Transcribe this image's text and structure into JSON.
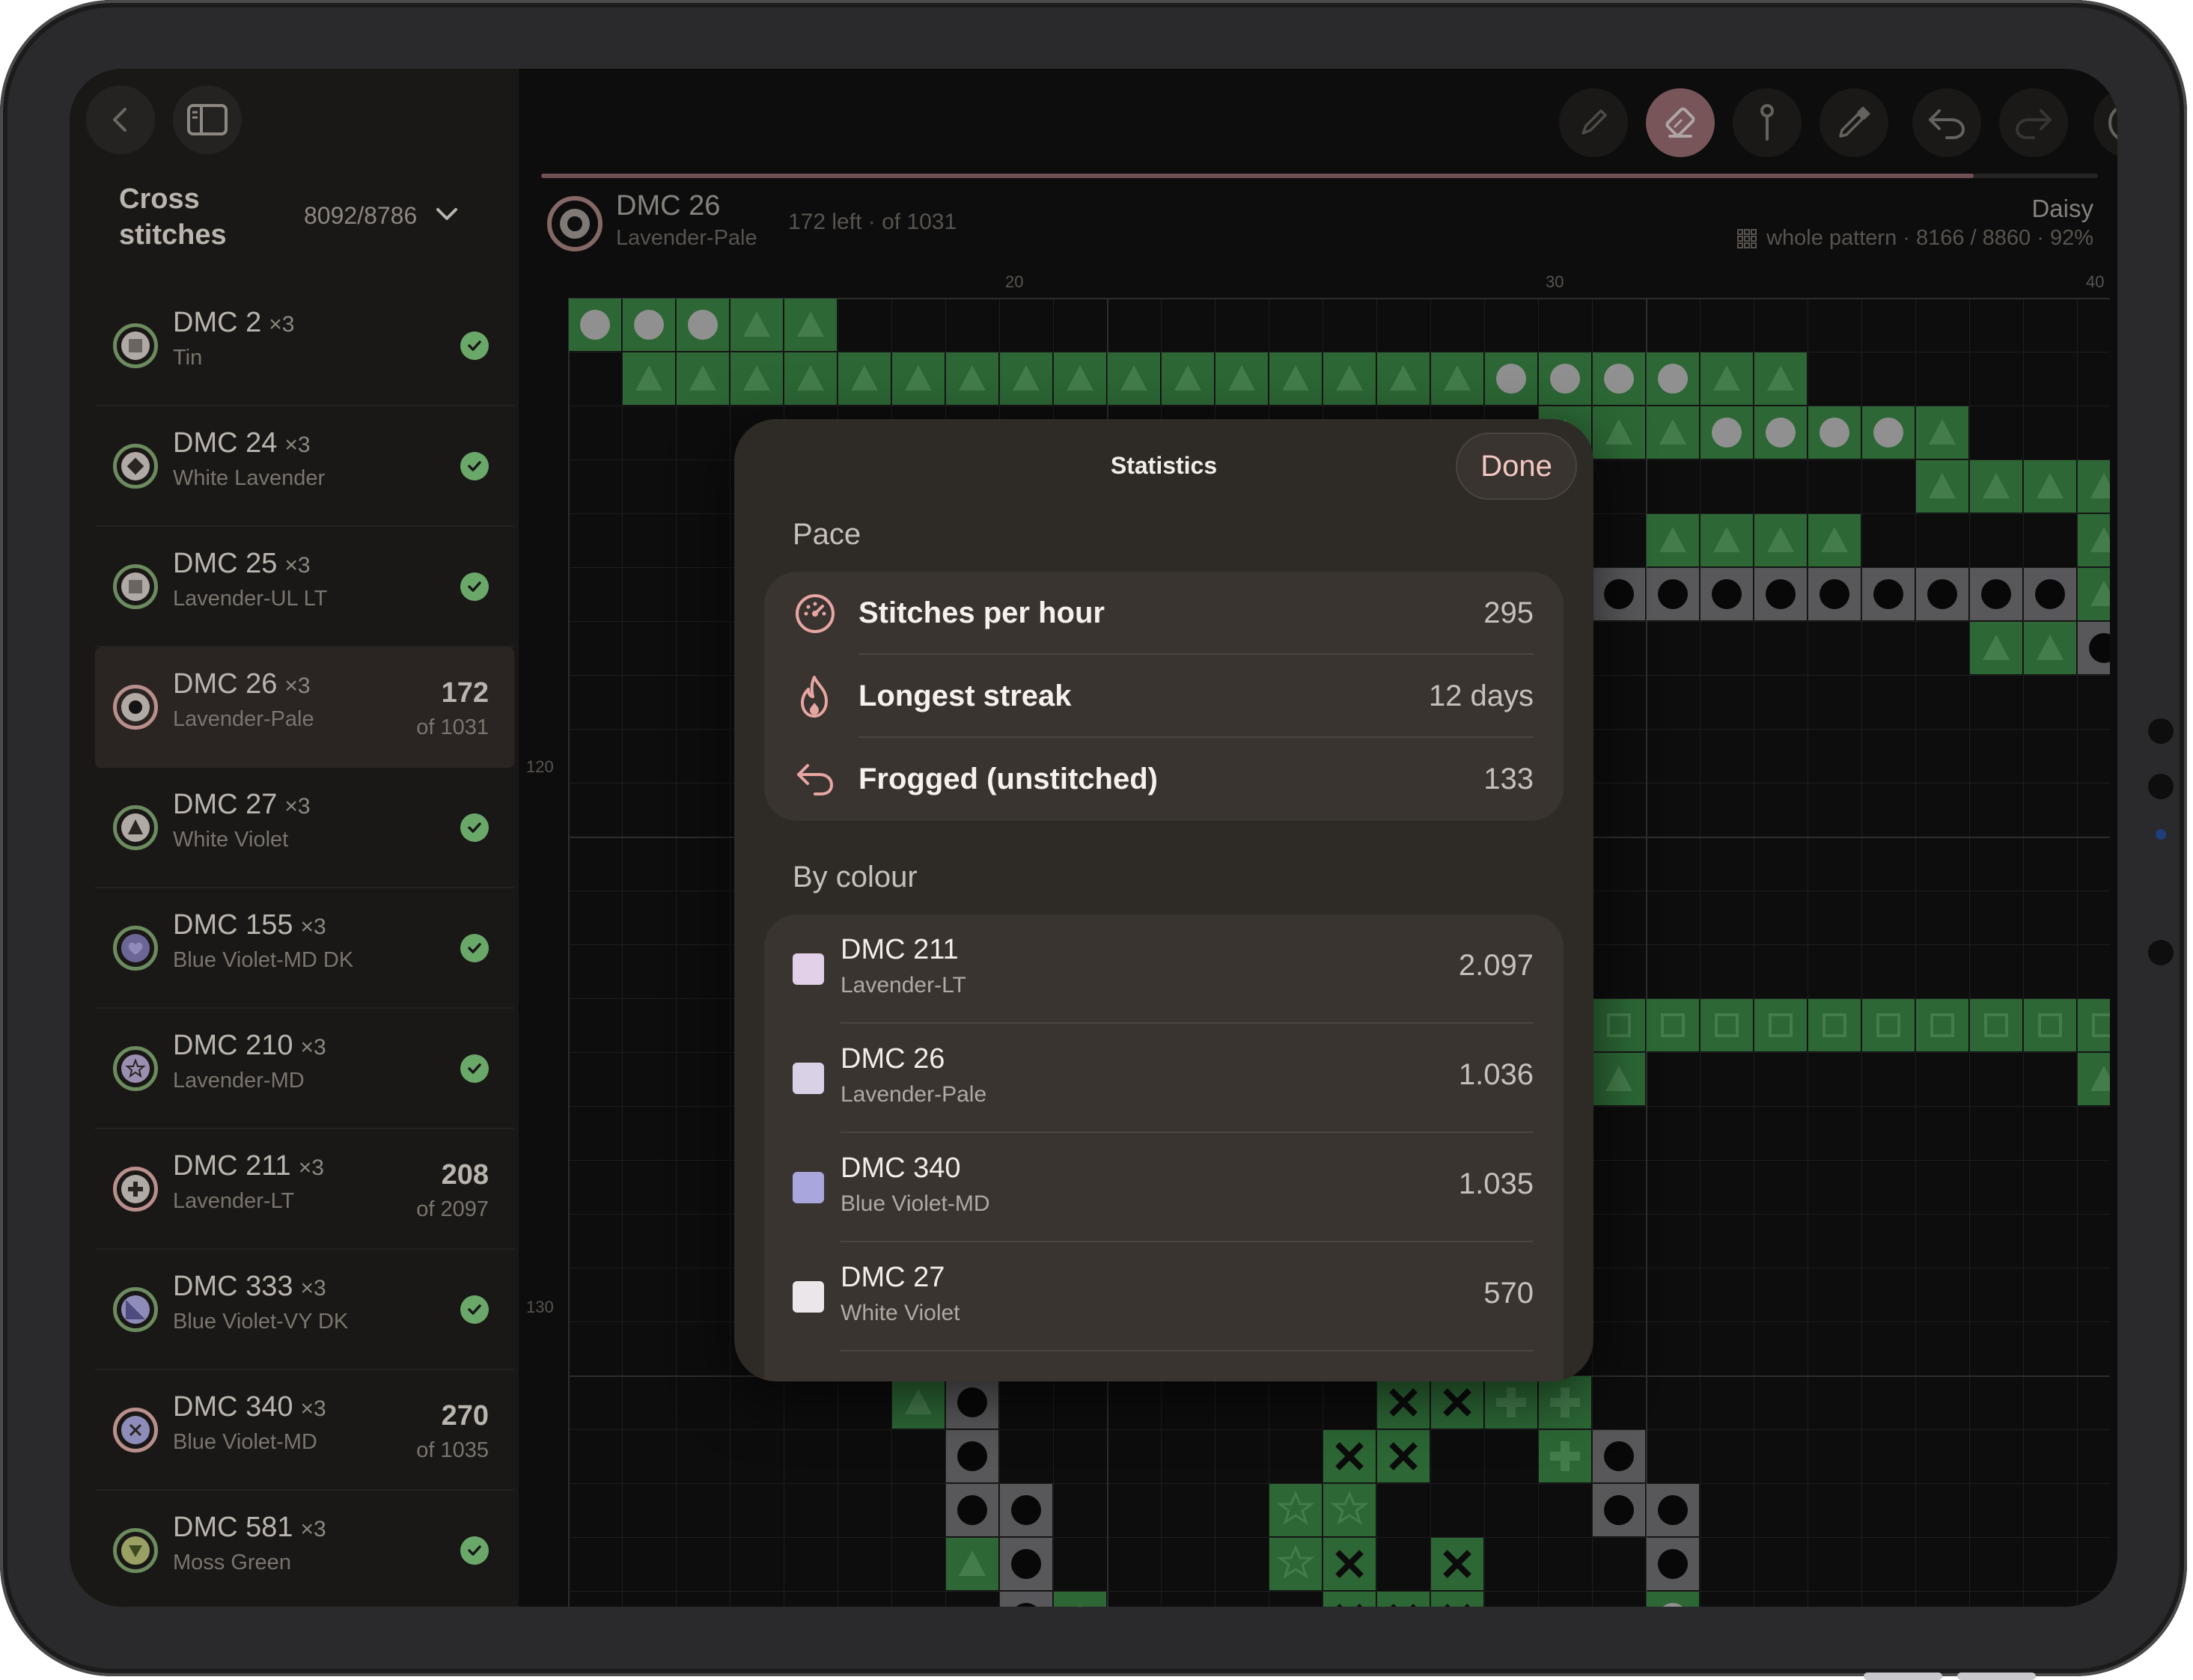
{
  "sidebar": {
    "title": "Cross stitches",
    "count": "8092/8786",
    "items": [
      {
        "name": "DMC 2",
        "mult": "×3",
        "sub": "Tin",
        "done": true,
        "shape": "square"
      },
      {
        "name": "DMC 24",
        "mult": "×3",
        "sub": "White Lavender",
        "done": true,
        "shape": "diamond"
      },
      {
        "name": "DMC 25",
        "mult": "×3",
        "sub": "Lavender-UL LT",
        "done": true,
        "shape": "square"
      },
      {
        "name": "DMC 26",
        "mult": "×3",
        "sub": "Lavender-Pale",
        "done": false,
        "progress": "172",
        "of": "of 1031",
        "shape": "dot",
        "selected": true
      },
      {
        "name": "DMC 27",
        "mult": "×3",
        "sub": "White Violet",
        "done": true,
        "shape": "triangle"
      },
      {
        "name": "DMC 155",
        "mult": "×3",
        "sub": "Blue Violet-MD DK",
        "done": true,
        "shape": "heart"
      },
      {
        "name": "DMC 210",
        "mult": "×3",
        "sub": "Lavender-MD",
        "done": true,
        "shape": "star"
      },
      {
        "name": "DMC 211",
        "mult": "×3",
        "sub": "Lavender-LT",
        "done": false,
        "progress": "208",
        "of": "of 2097",
        "shape": "plus"
      },
      {
        "name": "DMC 333",
        "mult": "×3",
        "sub": "Blue Violet-VY DK",
        "done": true,
        "shape": "corner"
      },
      {
        "name": "DMC 340",
        "mult": "×3",
        "sub": "Blue Violet-MD",
        "done": false,
        "progress": "270",
        "of": "of 1035",
        "shape": "cross"
      },
      {
        "name": "DMC 581",
        "mult": "×3",
        "sub": "Moss Green",
        "done": true,
        "shape": "down"
      }
    ]
  },
  "header": {
    "current_name": "DMC 26",
    "current_sub": "Lavender-Pale",
    "current_left": "172 left · of 1031",
    "pattern_name": "Daisy",
    "pattern_info": "whole pattern · 8166 / 8860 · 92%",
    "progress_fraction": 0.92
  },
  "ruler": {
    "x": [
      "20",
      "30",
      "40"
    ],
    "y": [
      "120",
      "130"
    ]
  },
  "modal": {
    "title": "Statistics",
    "done_label": "Done",
    "pace_label": "Pace",
    "pace": [
      {
        "label": "Stitches per hour",
        "value": "295",
        "icon": "speedometer-icon"
      },
      {
        "label": "Longest streak",
        "value": "12 days",
        "icon": "flame-icon"
      },
      {
        "label": "Frogged (unstitched)",
        "value": "133",
        "icon": "undo-arrow-icon"
      }
    ],
    "by_colour_label": "By colour",
    "colours": [
      {
        "name": "DMC 211",
        "sub": "Lavender-LT",
        "value": "2.097",
        "swatch": "#e2cfe8"
      },
      {
        "name": "DMC 26",
        "sub": "Lavender-Pale",
        "value": "1.036",
        "swatch": "#d9d2e6"
      },
      {
        "name": "DMC 340",
        "sub": "Blue Violet-MD",
        "value": "1.035",
        "swatch": "#a8a6dc"
      },
      {
        "name": "DMC 27",
        "sub": "White Violet",
        "value": "570",
        "swatch": "#ebe6ea"
      }
    ]
  },
  "colors": {
    "accent": "#a5767a",
    "stitched_green": "#3e8f4a",
    "done_check": "#6aa86a"
  }
}
